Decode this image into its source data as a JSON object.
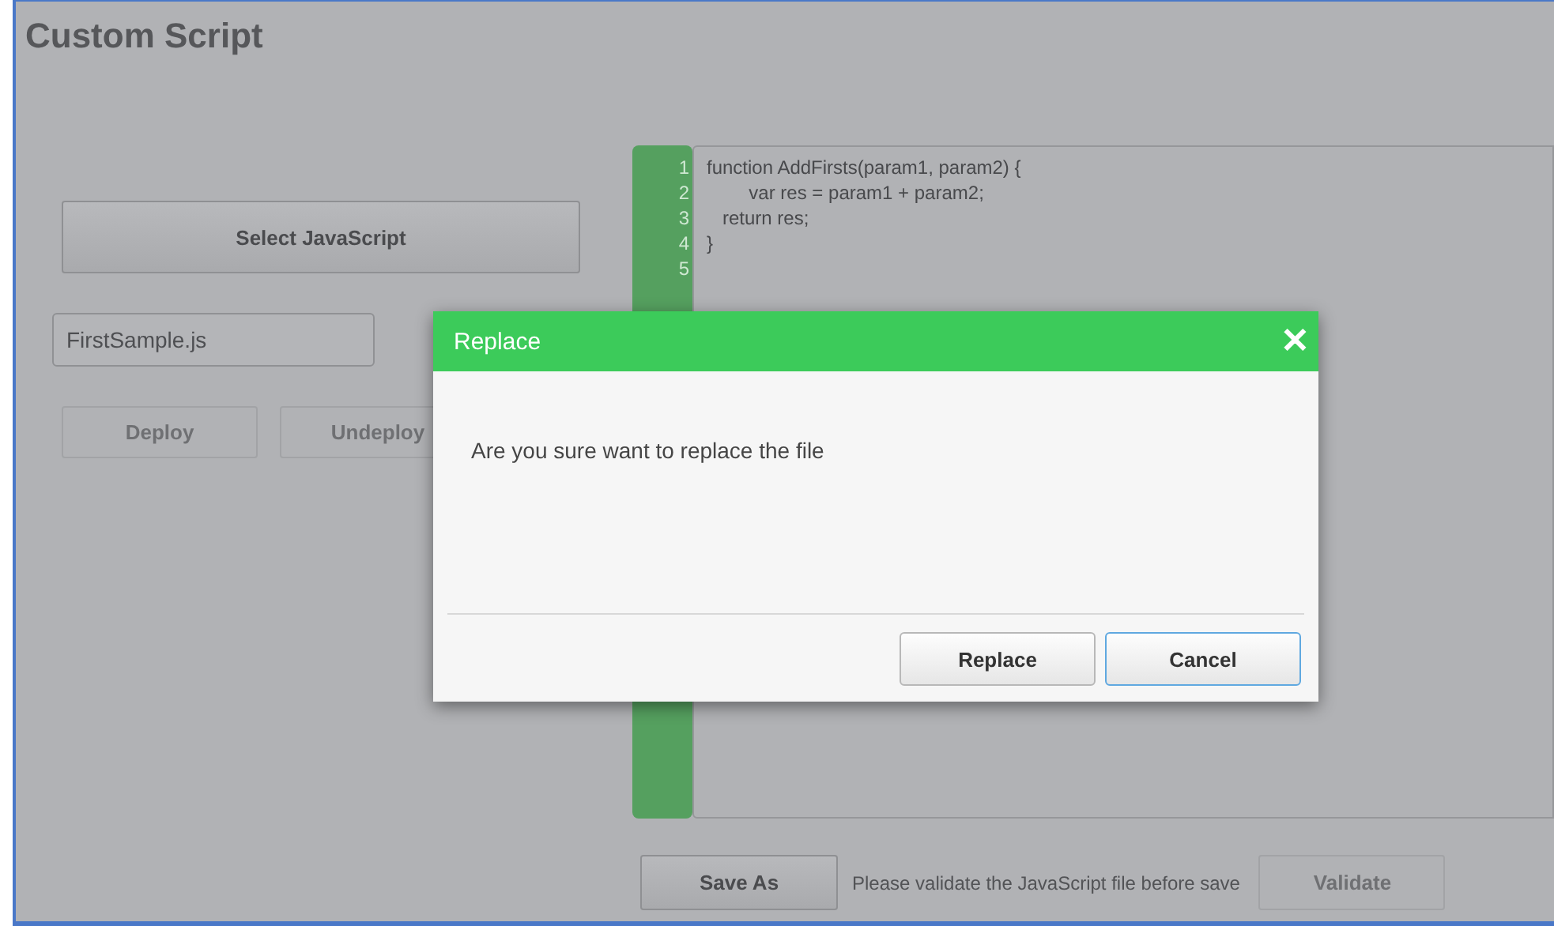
{
  "page": {
    "title": "Custom Script"
  },
  "left_panel": {
    "select_button": "Select JavaScript",
    "file_field": {
      "value": "FirstSample.js"
    },
    "actions": [
      {
        "label": "Deploy",
        "disabled": true
      },
      {
        "label": "Undeploy",
        "disabled": true
      }
    ]
  },
  "editor": {
    "lines": [
      {
        "number": "1",
        "code": "function AddFirsts(param1, param2) {"
      },
      {
        "number": "2",
        "code": "        var res = param1 + param2;"
      },
      {
        "number": "3",
        "code": "   return res;"
      },
      {
        "number": "4",
        "code": "}"
      },
      {
        "number": "5"
      }
    ]
  },
  "footer": {
    "save_as_button": "Save As",
    "hint": "Please validate the JavaScript file before save",
    "validate_button": {
      "label": "Validate",
      "disabled": true
    }
  },
  "dialog": {
    "title": "Replace",
    "close": "✕",
    "message": "Are you sure want to replace the file",
    "buttons": [
      {
        "label": "Replace",
        "focused": false
      },
      {
        "label": "Cancel",
        "focused": true
      }
    ]
  }
}
